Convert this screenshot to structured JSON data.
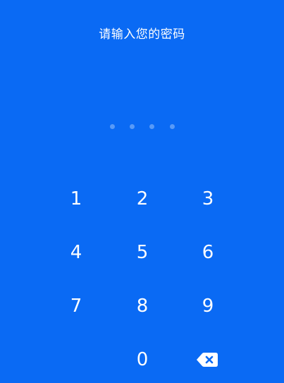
{
  "title": "请输入您的密码",
  "passcode": {
    "length": 4,
    "filled": 0
  },
  "keypad": {
    "k1": "1",
    "k2": "2",
    "k3": "3",
    "k4": "4",
    "k5": "5",
    "k6": "6",
    "k7": "7",
    "k8": "8",
    "k9": "9",
    "k0": "0",
    "backspace_icon": "backspace-icon"
  },
  "colors": {
    "background": "#0a6af4",
    "text": "#ffffff",
    "dot": "#ffffff52"
  }
}
